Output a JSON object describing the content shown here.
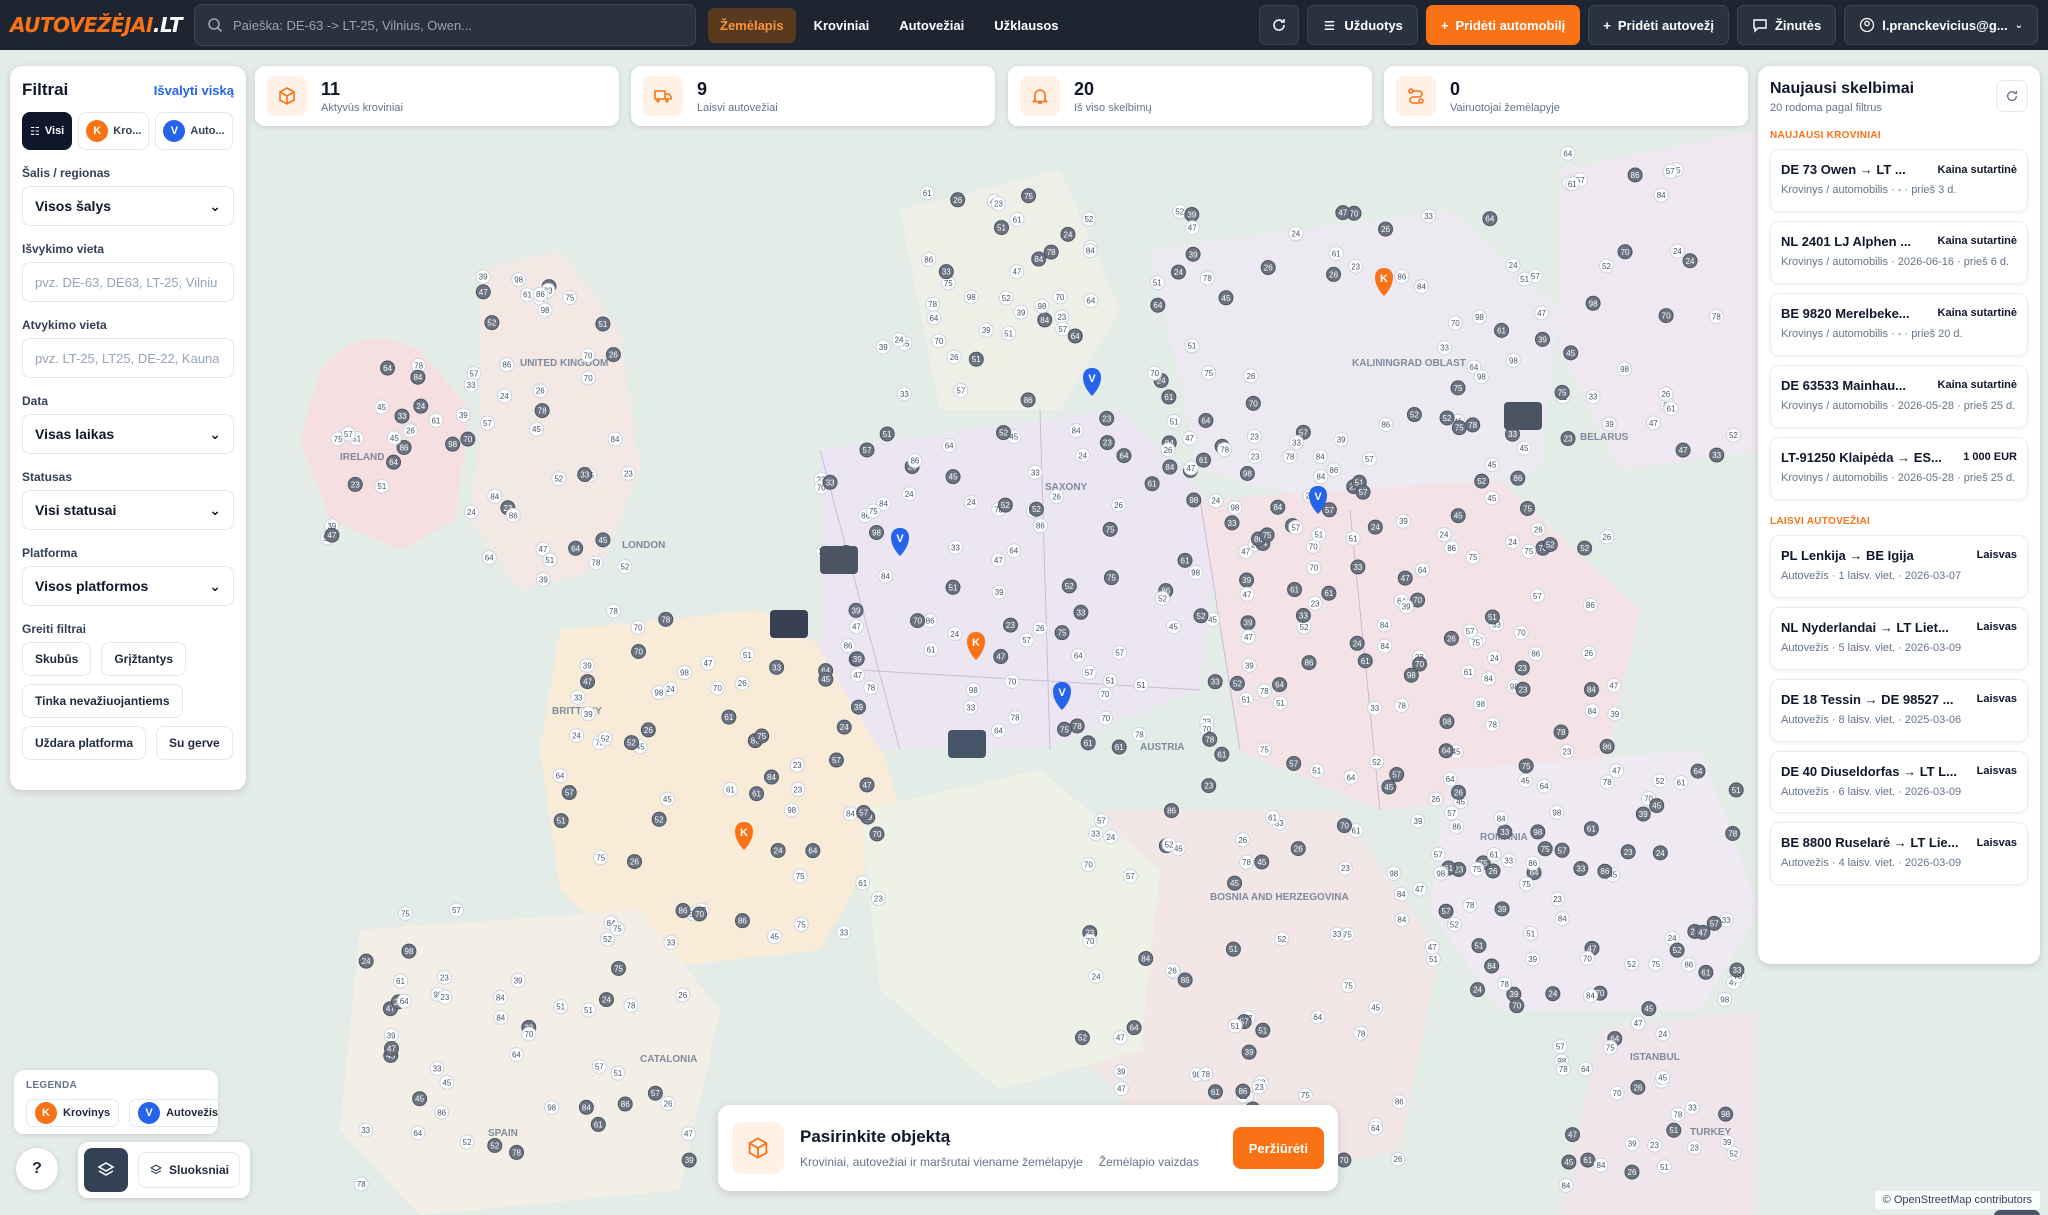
{
  "header": {
    "logo_part1": "AUTOVEŽĖJAI",
    "logo_part2": ".LT",
    "search_placeholder": "Paieška: DE-63 -> LT-25, Vilnius, Owen...",
    "nav": [
      {
        "label": "Žemėlapis",
        "active": true
      },
      {
        "label": "Kroviniai",
        "active": false
      },
      {
        "label": "Autovežiai",
        "active": false
      },
      {
        "label": "Užklausos",
        "active": false
      }
    ],
    "tasks_label": "Užduotys",
    "add_car_label": "Pridėti automobilį",
    "add_carrier_label": "Pridėti autovežį",
    "messages_label": "Žinutės",
    "user_label": "l.pranckevicius@g..."
  },
  "filters": {
    "title": "Filtrai",
    "clear_label": "Išvalyti viską",
    "types": [
      {
        "label": "Visi",
        "icon": "grid-icon",
        "active": true
      },
      {
        "label": "Kro...",
        "badge": "K",
        "active": false
      },
      {
        "label": "Auto...",
        "badge": "V",
        "active": false
      }
    ],
    "country_label": "Šalis / regionas",
    "country_value": "Visos šalys",
    "pickup_label": "Išvykimo vieta",
    "pickup_placeholder": "pvz. DE-63, DE63, LT-25, Vilniu",
    "dropoff_label": "Atvykimo vieta",
    "dropoff_placeholder": "pvz. LT-25, LT25, DE-22, Kauna",
    "date_label": "Data",
    "date_value": "Visas laikas",
    "status_label": "Statusas",
    "status_value": "Visi statusai",
    "platform_label": "Platforma",
    "platform_value": "Visos platformos",
    "quick_label": "Greiti filtrai",
    "quick_chips": [
      "Skubūs",
      "Grįžtantys",
      "Tinka nevažiuojantiems",
      "Uždara platforma",
      "Su gerve"
    ]
  },
  "stats": [
    {
      "value": "11",
      "label": "Aktyvūs kroviniai",
      "icon": "box-icon"
    },
    {
      "value": "9",
      "label": "Laisvi autovežiai",
      "icon": "truck-icon"
    },
    {
      "value": "20",
      "label": "Iš viso skelbimų",
      "icon": "bell-icon"
    },
    {
      "value": "0",
      "label": "Vairuotojai žemėlapyje",
      "icon": "route-icon"
    }
  ],
  "latest": {
    "title": "Naujausi skelbimai",
    "subtitle": "20 rodoma pagal filtrus",
    "cargo_section": "NAUJAUSI KROVINIAI",
    "cargo": [
      {
        "name": "DE 73 Owen → LT ...",
        "price": "Kaina sutartinė",
        "meta": "Krovinys / automobilis · - · prieš 3 d."
      },
      {
        "name": "NL 2401 LJ Alphen ...",
        "price": "Kaina sutartinė",
        "meta": "Krovinys / automobilis · 2026-06-16 · prieš 6 d."
      },
      {
        "name": "BE 9820 Merelbeke...",
        "price": "Kaina sutartinė",
        "meta": "Krovinys / automobilis · - · prieš 20 d."
      },
      {
        "name": "DE 63533 Mainhau...",
        "price": "Kaina sutartinė",
        "meta": "Krovinys / automobilis · 2026-05-28 · prieš 25 d."
      },
      {
        "name": "LT-91250 Klaipėda → ES...",
        "price": "1 000 EUR",
        "meta": "Krovinys / automobilis · 2026-05-28 · prieš 25 d."
      }
    ],
    "carrier_section": "LAISVI AUTOVEŽIAI",
    "carriers": [
      {
        "name": "PL Lenkija → BE Igija",
        "status": "Laisvas",
        "meta": "Autovežis · 1 laisv. viet. · 2026-03-07"
      },
      {
        "name": "NL Nyderlandai → LT Liet...",
        "status": "Laisvas",
        "meta": "Autovežis · 5 laisv. viet. · 2026-03-09"
      },
      {
        "name": "DE 18 Tessin → DE 98527 ...",
        "status": "Laisvas",
        "meta": "Autovežis · 8 laisv. viet. · 2025-03-06"
      },
      {
        "name": "DE 40 Diuseldorfas → LT L...",
        "status": "Laisvas",
        "meta": "Autovežis · 6 laisv. viet. · 2026-03-09"
      },
      {
        "name": "BE 8800 Ruselarė → LT Lie...",
        "status": "Laisvas",
        "meta": "Autovežis · 4 laisv. viet. · 2026-03-09"
      }
    ]
  },
  "legend": {
    "title": "LEGENDA",
    "cargo_label": "Krovinys",
    "carrier_label": "Autovežis"
  },
  "layers_label": "Sluoksniai",
  "bottom_card": {
    "title": "Pasirinkite objektą",
    "subtitle": "Kroviniai, autovežiai ir maršrutai viename žemėlapyje",
    "view_label": "Žemėlapio vaizdas",
    "button": "Peržiūrėti"
  },
  "map": {
    "attribution": "© OpenStreetMap contributors",
    "labels": [
      "UNITED KINGDOM",
      "LONDON",
      "IRELAND",
      "BRITTANY",
      "SPAIN",
      "CATALONIA",
      "AUSTRIA",
      "SAXONY",
      "KALININGRAD OBLAST",
      "ROMANIA",
      "TURKEY",
      "BELARUS",
      "BOSNIA AND HERZEGOVINA",
      "ISTANBUL"
    ],
    "cluster_counts": [
      "64",
      "51",
      "39",
      "45",
      "78",
      "23",
      "86",
      "52",
      "75",
      "57",
      "24",
      "70",
      "33",
      "61",
      "47",
      "98",
      "26",
      "84"
    ]
  }
}
